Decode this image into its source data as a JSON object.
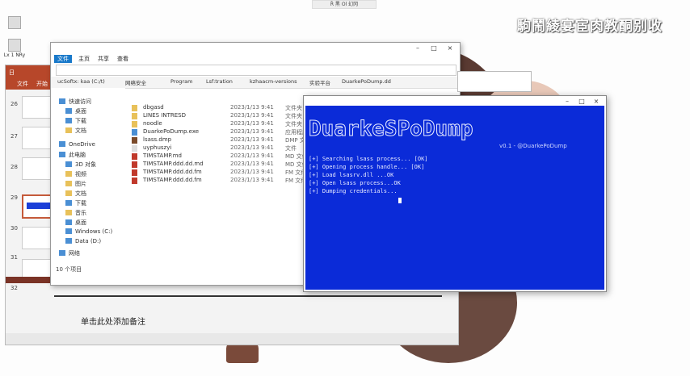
{
  "desktop": {
    "watermark": "駒鬧綾宴宦肉教酮别收",
    "top_tab": "Ȑ 黑 Ol 幻冈",
    "icons": [
      "",
      "Lx 1 NRy"
    ],
    "colors": {
      "accent": "#1979ca",
      "terminal_bg": "#0b2bd8",
      "ppt_ribbon": "#b7472a"
    }
  },
  "ppt": {
    "ribbon_items": [
      "日",
      "文件",
      "开始"
    ],
    "slide_numbers": [
      "26",
      "27",
      "28",
      "29",
      "30",
      "31",
      "32"
    ],
    "notes_placeholder": "单击此处添加备注"
  },
  "explorer": {
    "title": "",
    "address": "",
    "ribbon_tabs": [
      "文件",
      "主页",
      "共享",
      "查看"
    ],
    "quick_tabs": [
      "ucSoftx: kaa (C:/t)",
      "网络安全",
      "Program",
      "Lsf:tration",
      "kzhaacm-versions",
      "实验平台",
      "DuarkePoDump.dd"
    ],
    "nav": [
      "快速访问",
      "桌面",
      "下载",
      "文档",
      "OneDrive",
      "此电脑",
      "3D 对象",
      "视频",
      "图片",
      "文档",
      "下载",
      "音乐",
      "桌面",
      "Windows (C:)",
      "Data (D:)",
      "网络"
    ],
    "files": [
      {
        "name": "dbgasd",
        "date": "2023/1/13 9:41",
        "type": "文件夹"
      },
      {
        "name": "LINES INTRESD",
        "date": "2023/1/13 9:41",
        "type": "文件夹"
      },
      {
        "name": "noodle",
        "date": "2023/1/13 9:41",
        "type": "文件夹"
      },
      {
        "name": "DuarkePoDump.exe",
        "date": "2023/1/13 9:41",
        "type": "应用程序"
      },
      {
        "name": "lsass.dmp",
        "date": "2023/1/13 9:41",
        "type": "DMP 文件"
      },
      {
        "name": "uyphuszyi",
        "date": "2023/1/13 9:41",
        "type": "文件"
      },
      {
        "name": "TIMSTAMP.md",
        "date": "2023/1/13 9:41",
        "type": "MD 文件"
      },
      {
        "name": "TIMSTAMP.ddd.dd.md",
        "date": "2023/1/13 9:41",
        "type": "MD 文件"
      },
      {
        "name": "TIMSTAMP.ddd.dd.fm",
        "date": "2023/1/13 9:41",
        "type": "FM 文件"
      },
      {
        "name": "TIMSTAMP.ddd.dd.fm",
        "date": "2023/1/13 9:41",
        "type": "FM 文件"
      }
    ],
    "status": "10 个项目"
  },
  "terminal": {
    "title": "",
    "banner": "DuarkeSPoDump",
    "banner_sub": "v0.1 - @DuarkePoDump",
    "lines": [
      "[+] Searching lsass process...  [OK]",
      "[+] Opening process handle...  [OK]",
      "[+] Load lsasrv.dll ...OK",
      "[+] Open lsass process...OK",
      "[+] Dumping credentials..."
    ]
  }
}
